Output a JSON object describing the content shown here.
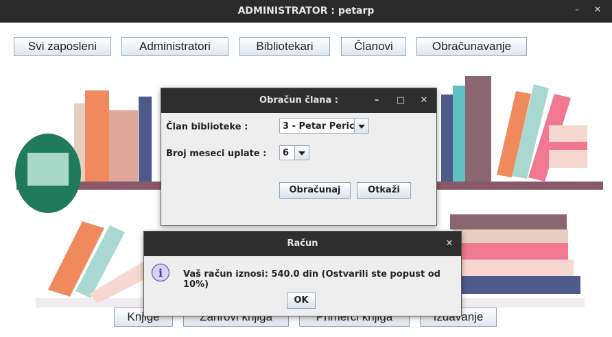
{
  "window": {
    "title": "ADMINISTRATOR : petarp"
  },
  "top_buttons": [
    "Svi zaposleni",
    "Administratori",
    "Bibliotekari",
    "Članovi",
    "Obračunavanje"
  ],
  "bottom_buttons": [
    "Knjige",
    "Žanrovi knjiga",
    "Primerci knjiga",
    "Izdavanje"
  ],
  "obracun_dialog": {
    "title": "Obračun člana :",
    "member_label": "Član biblioteke :",
    "member_value": "3 - Petar Peric",
    "months_label": "Broj meseci uplate :",
    "months_value": "6",
    "calc_button": "Obračunaj",
    "cancel_button": "Otkaži"
  },
  "racun_dialog": {
    "title": "Račun",
    "message": "Vaš račun iznosi: 540.0 din (Ostvarili ste popust od 10%)",
    "ok_button": "OK"
  },
  "colors": {
    "titlebar": "#2b2b2b",
    "shelf": "#8a5a6a",
    "button_border": "#8fa3b8",
    "info_icon": "#7a6fc0"
  },
  "icons": [
    "minimize-icon",
    "maximize-icon",
    "close-icon",
    "info-icon",
    "dropdown-arrow-icon"
  ]
}
